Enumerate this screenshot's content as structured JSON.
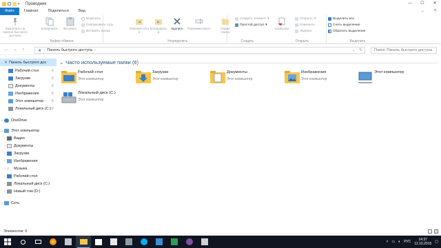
{
  "window": {
    "title": "Проводник",
    "min_glyph": "—",
    "max_glyph": "☐",
    "close_glyph": "✕"
  },
  "tabs": [
    "Файл",
    "Главная",
    "Поделиться",
    "Вид"
  ],
  "ribbon": {
    "clipboard": {
      "group_label": "Буфер обмена",
      "pin_label": "Закрепить на панели быстрого доступа",
      "copy_label": "Копировать",
      "paste_label": "Вставить",
      "cut_label": "Вырезать",
      "copy_path_label": "Скопировать путь",
      "paste_shortcut_label": "Вставить ярлык"
    },
    "organize": {
      "group_label": "Упорядочить",
      "move_label": "Переместить в",
      "copy_to_label": "Копировать в",
      "delete_label": "Удалить",
      "rename_label": "Переименовать"
    },
    "create": {
      "group_label": "Создать",
      "new_folder_label": "Новая папка",
      "new_item_label": "Создать элемент",
      "easy_access_label": "Простой доступ"
    },
    "open": {
      "group_label": "Открыть",
      "properties_label": "Свойства",
      "open_label": "Открыть",
      "edit_label": "Изменить",
      "history_label": "Журнал"
    },
    "select": {
      "group_label": "Выделить",
      "select_all_label": "Выделить все",
      "select_none_label": "Снять выделение",
      "invert_label": "Обратить выделение"
    }
  },
  "addressbar": {
    "back": "←",
    "forward": "→",
    "up": "↑",
    "path": "Панель быстрого доступа",
    "separator": "›",
    "search_placeholder": "Поиск: Панель быстрого доступа"
  },
  "nav": {
    "quick_access": "Панель быстрого дос",
    "quick_items": [
      {
        "label": "Рабочий стол",
        "icon": "desktop-icon"
      },
      {
        "label": "Загрузки",
        "icon": "downloads-icon"
      },
      {
        "label": "Документы",
        "icon": "documents-icon"
      },
      {
        "label": "Изображения",
        "icon": "pictures-icon"
      },
      {
        "label": "Этот компьютер",
        "icon": "pc-icon"
      },
      {
        "label": "Локальный диск (C:)",
        "icon": "drive-icon"
      }
    ],
    "onedrive": "OneDrive",
    "this_pc": "Этот компьютер",
    "pc_items": [
      {
        "label": "Видео",
        "icon": "video-icon"
      },
      {
        "label": "Документы",
        "icon": "documents-icon"
      },
      {
        "label": "Загрузки",
        "icon": "downloads-icon"
      },
      {
        "label": "Изображения",
        "icon": "pictures-icon"
      },
      {
        "label": "Музыка",
        "icon": "music-icon"
      },
      {
        "label": "Рабочий стол",
        "icon": "desktop-icon"
      },
      {
        "label": "Локальный диск (C:)",
        "icon": "drive-icon"
      },
      {
        "label": "Новый том (D:)",
        "icon": "drive-icon"
      }
    ],
    "network": "Сеть"
  },
  "content": {
    "section_title": "Часто используемые папки (6)",
    "tiles": [
      {
        "name": "Рабочий стол",
        "sub": "Этот компьютер",
        "icon": "desktop-folder-icon"
      },
      {
        "name": "Загрузки",
        "sub": "Этот компьютер",
        "icon": "downloads-folder-icon"
      },
      {
        "name": "Документы",
        "sub": "Этот компьютер",
        "icon": "documents-folder-icon"
      },
      {
        "name": "Изображения",
        "sub": "Этот компьютер",
        "icon": "pictures-folder-icon"
      },
      {
        "name": "Этот компьютер",
        "sub": "",
        "icon": "pc-icon"
      },
      {
        "name": "Локальный диск (C:)",
        "sub": "Этот компьютер",
        "icon": "drive-icon"
      }
    ]
  },
  "status": {
    "items_count": "Элементов: 6"
  },
  "taskbar": {
    "lang": "РУС",
    "time": "14:37",
    "date": "12.10.2015"
  },
  "colors": {
    "accent": "#1979ca",
    "folder": "#f5c64b",
    "taskbar": "#101521",
    "selection": "#cce8ff"
  }
}
